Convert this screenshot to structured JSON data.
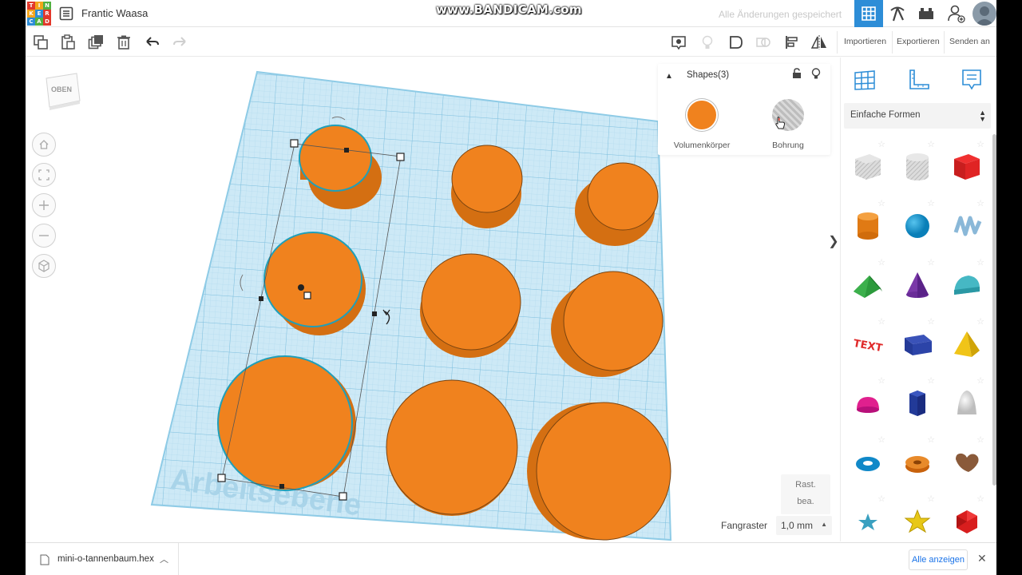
{
  "app": {
    "logo_letters": [
      "T",
      "I",
      "N",
      "K",
      "E",
      "R",
      "C",
      "A",
      "D"
    ],
    "project_name": "Frantic Waasa",
    "recorder_watermark": "www.BANDICAM.com",
    "save_status": "Alle Änderungen gespeichert"
  },
  "toolbar": {
    "import_label": "Importieren",
    "export_label": "Exportieren",
    "send_label": "Senden an"
  },
  "workplane": {
    "viewcube_label": "OBEN",
    "plane_label": "Arbeitsebene"
  },
  "inspector": {
    "title": "Shapes(3)",
    "solid_label": "Volumenkörper",
    "hole_label": "Bohrung",
    "solid_color": "#f0821e"
  },
  "grid_panel": {
    "line1": "Rast.",
    "line2": "bea."
  },
  "snap": {
    "label": "Fangraster",
    "value": "1,0 mm"
  },
  "library": {
    "category": "Einfache Formen",
    "shapes": [
      "box-hole",
      "cylinder-hole",
      "box",
      "cylinder",
      "sphere",
      "scribble",
      "roof",
      "cone",
      "round-roof",
      "text",
      "half-cylinder",
      "pyramid",
      "half-sphere",
      "polygon",
      "paraboloid",
      "torus",
      "tube",
      "heart",
      "star",
      "star-yellow",
      "icosahedron"
    ]
  },
  "downloads": {
    "file_name": "mini-o-tannenbaum.hex",
    "show_all": "Alle anzeigen"
  },
  "colors": {
    "accent": "#2d8dd7",
    "shape_orange": "#f0821e",
    "grid_blue": "#bfe3f4"
  }
}
